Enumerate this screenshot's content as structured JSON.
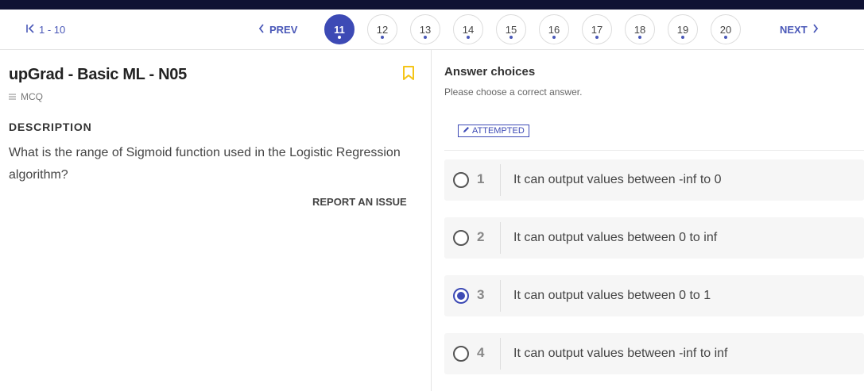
{
  "pager": {
    "first_label": "1 - 10",
    "prev_label": "PREV",
    "next_label": "NEXT",
    "pages": [
      "11",
      "12",
      "13",
      "14",
      "15",
      "16",
      "17",
      "18",
      "19",
      "20"
    ],
    "active_page": "11"
  },
  "question": {
    "title": "upGrad - Basic ML - N05",
    "type": "MCQ",
    "description_heading": "DESCRIPTION",
    "description": "What is the range of Sigmoid function used in the Logistic Regression algorithm?",
    "report_label": "REPORT AN ISSUE"
  },
  "answers": {
    "heading": "Answer choices",
    "subheading": "Please choose a correct answer.",
    "status": "ATTEMPTED",
    "options": [
      {
        "num": "1",
        "text": "It can output values between -inf to 0",
        "selected": false
      },
      {
        "num": "2",
        "text": "It can output values between 0 to inf",
        "selected": false
      },
      {
        "num": "3",
        "text": "It can output values between 0 to 1",
        "selected": true
      },
      {
        "num": "4",
        "text": "It can output values between -inf to inf",
        "selected": false
      }
    ]
  },
  "colors": {
    "accent": "#3d4ab5",
    "topbar": "#0f1233",
    "bookmark": "#f5c518"
  },
  "icons": [
    "first-page-icon",
    "chevron-left-icon",
    "chevron-right-icon",
    "bookmark-icon",
    "list-icon",
    "pencil-icon"
  ]
}
